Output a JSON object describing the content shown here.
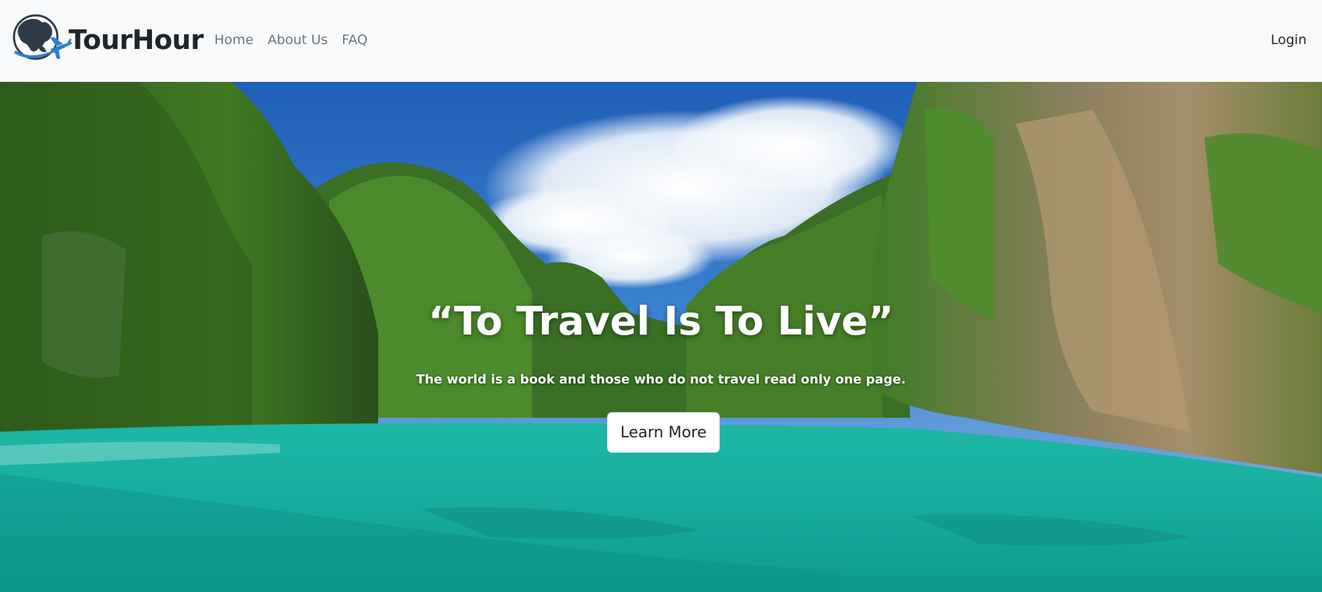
{
  "nav": {
    "brand": "TourHour",
    "links": [
      {
        "label": "Home"
      },
      {
        "label": "About Us"
      },
      {
        "label": "FAQ"
      }
    ],
    "login": "Login"
  },
  "hero": {
    "title": "“To Travel Is To Live”",
    "subtitle": "The world is a book and those who do not travel read only one page.",
    "button": "Learn More",
    "image": "tropical-lagoon-limestone-cliffs"
  },
  "colors": {
    "navbar_bg": "#f8f9fa",
    "brand_text": "#212529",
    "nav_link": "#6c757d",
    "logo_blue": "#2f7fd0",
    "logo_dark": "#2f3b48",
    "water": "#1aa79b",
    "sky": "#2f6fc4"
  }
}
